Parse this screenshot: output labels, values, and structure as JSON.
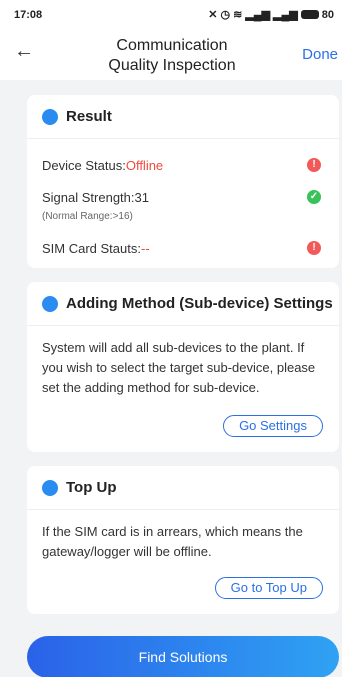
{
  "status_bar": {
    "time": "17:08",
    "battery": "80"
  },
  "nav": {
    "back_icon": "arrow-left-icon",
    "title_line1": "Communication",
    "title_line2": "Quality Inspection",
    "done_label": "Done"
  },
  "result": {
    "title": "Result",
    "device_status_label": "Device Status:",
    "device_status_value": "Offline",
    "signal_label": "Signal Strength:",
    "signal_value": "31",
    "signal_range": "(Normal Range:>16)",
    "sim_label": "SIM Card Stauts:",
    "sim_value": "--"
  },
  "adding_method": {
    "title": "Adding Method (Sub-device) Settings",
    "text": "System will add all sub-devices to the plant. If you wish to select the target sub-device, please set the adding method for sub-device.",
    "button_label": "Go Settings"
  },
  "top_up": {
    "title": "Top Up",
    "text": "If the SIM card is in arrears, which means the gateway/logger will be offline.",
    "button_label": "Go to Top Up"
  },
  "footer": {
    "button_label": "Find Solutions"
  },
  "colors": {
    "accent": "#2b6fe6",
    "error": "#f04a3c",
    "ok": "#3ac25a"
  }
}
